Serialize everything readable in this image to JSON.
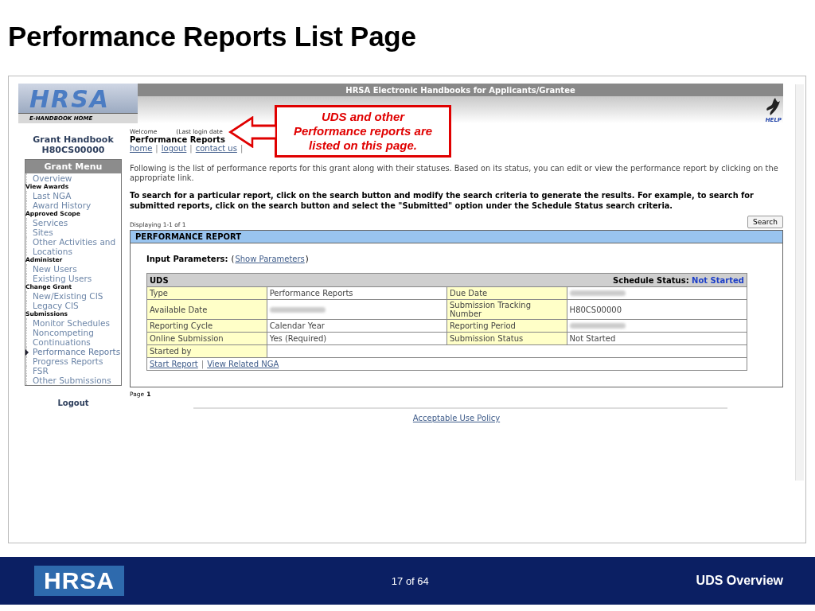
{
  "slide_title": "Performance Reports List Page",
  "app": {
    "agency_line": "E-HANDBOOK HOME",
    "logo": "HRSA",
    "header_title": "HRSA Electronic Handbooks for Applicants/Grantee",
    "help": "HELP",
    "sidebar": {
      "handbook_title": "Grant Handbook",
      "handbook_id": "H80CS00000",
      "menu_title": "Grant Menu",
      "items": [
        {
          "kind": "link",
          "label": "Overview",
          "selected": false
        },
        {
          "kind": "heading",
          "label": "View Awards"
        },
        {
          "kind": "link",
          "label": "Last NGA",
          "selected": false
        },
        {
          "kind": "link",
          "label": "Award History",
          "selected": false
        },
        {
          "kind": "heading",
          "label": "Approved Scope"
        },
        {
          "kind": "link",
          "label": "Services",
          "selected": false
        },
        {
          "kind": "link",
          "label": "Sites",
          "selected": false
        },
        {
          "kind": "link",
          "label": "Other Activities and Locations",
          "selected": false
        },
        {
          "kind": "heading",
          "label": "Administer"
        },
        {
          "kind": "link",
          "label": "New Users",
          "selected": false
        },
        {
          "kind": "link",
          "label": "Existing Users",
          "selected": false
        },
        {
          "kind": "heading",
          "label": "Change Grant"
        },
        {
          "kind": "link",
          "label": "New/Existing CIS",
          "selected": false
        },
        {
          "kind": "link",
          "label": "Legacy CIS",
          "selected": false
        },
        {
          "kind": "heading",
          "label": "Submissions"
        },
        {
          "kind": "link",
          "label": "Monitor Schedules",
          "selected": false
        },
        {
          "kind": "link",
          "label": "Noncompeting Continuations",
          "selected": false
        },
        {
          "kind": "link",
          "label": "Performance Reports",
          "selected": true
        },
        {
          "kind": "link",
          "label": "Progress Reports",
          "selected": false
        },
        {
          "kind": "link",
          "label": "FSR",
          "selected": false
        },
        {
          "kind": "link",
          "label": "Other Submissions",
          "selected": false
        }
      ],
      "logout": "Logout"
    },
    "welcome": "Welcome",
    "last_login": "(Last login date",
    "page_heading": "Performance Reports",
    "nav_links": [
      {
        "label": "home",
        "separator": "|"
      },
      {
        "label": "logout",
        "separator": "|"
      },
      {
        "label": "contact us",
        "separator": "|"
      }
    ],
    "intro": "Following is the list of performance reports for this grant along with their statuses. Based on its status, you can edit or view the performance report by clicking on the appropriate link.",
    "search_hint": "To search for a particular report, click on the search button and modify the search criteria to generate the results. For example, to search for submitted reports, click on the search button and select the \"Submitted\" option under the Schedule Status search criteria.",
    "displaying": "Displaying 1-1 of 1",
    "search_button": "Search",
    "panel": {
      "title": "PERFORMANCE REPORT",
      "params_label": "Input Parameters:",
      "params_open": "(",
      "params_link": "Show Parameters",
      "params_close": ")",
      "report": {
        "name": "UDS",
        "status_label": "Schedule Status:",
        "status": "Not Started",
        "rows": [
          [
            {
              "kind": "label",
              "text": "Type"
            },
            {
              "kind": "value",
              "text": "Performance Reports"
            },
            {
              "kind": "label",
              "text": "Due Date"
            },
            {
              "kind": "redacted"
            }
          ],
          [
            {
              "kind": "label",
              "text": "Available Date"
            },
            {
              "kind": "redacted"
            },
            {
              "kind": "label",
              "text": "Submission Tracking Number"
            },
            {
              "kind": "value",
              "text": "H80CS00000"
            }
          ],
          [
            {
              "kind": "label",
              "text": "Reporting Cycle"
            },
            {
              "kind": "value",
              "text": "Calendar Year"
            },
            {
              "kind": "label",
              "text": "Reporting Period"
            },
            {
              "kind": "redacted"
            }
          ],
          [
            {
              "kind": "label",
              "text": "Online Submission"
            },
            {
              "kind": "value",
              "text": "Yes (Required)"
            },
            {
              "kind": "label",
              "text": "Submission Status"
            },
            {
              "kind": "value",
              "text": "Not Started"
            }
          ],
          [
            {
              "kind": "label",
              "text": "Started by"
            },
            {
              "kind": "wide"
            }
          ]
        ],
        "actions": [
          {
            "label": "Start Report",
            "separator": "|"
          },
          {
            "label": "View Related NGA"
          }
        ]
      }
    },
    "page_label": "Page",
    "page_number": "1",
    "policy_link": "Acceptable Use Policy"
  },
  "callout": "UDS and other Performance reports are listed on this page.",
  "footer": {
    "logo": "HRSA",
    "page": "17 of 64",
    "title": "UDS Overview"
  }
}
